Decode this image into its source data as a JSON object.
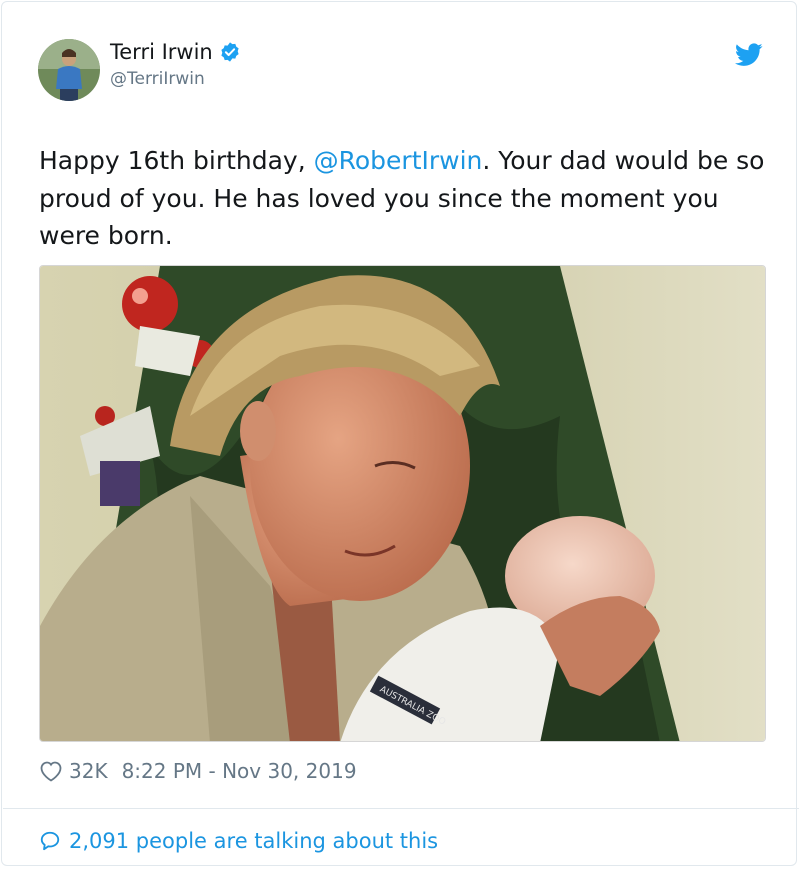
{
  "author": {
    "name": "Terri Irwin",
    "handle": "@TerriIrwin",
    "verified": true
  },
  "tweet": {
    "text_before": "Happy 16th birthday, ",
    "mention": "@RobertIrwin",
    "text_after": ". Your dad would be so proud of you. He has loved you since the moment you were born.",
    "photo_caption_tag": "AUSTRALIA ZOO"
  },
  "stats": {
    "likes": "32K",
    "timestamp": "8:22 PM - Nov 30, 2019"
  },
  "footer": {
    "talking": "2,091 people are talking about this"
  },
  "colors": {
    "link": "#1b95e0",
    "muted": "#657786",
    "text": "#14171a",
    "twitter_blue": "#1da1f2"
  },
  "icons": {
    "verified": "verified-badge-icon",
    "brand": "twitter-bird-icon",
    "like": "heart-icon",
    "reply": "speech-bubble-icon"
  }
}
